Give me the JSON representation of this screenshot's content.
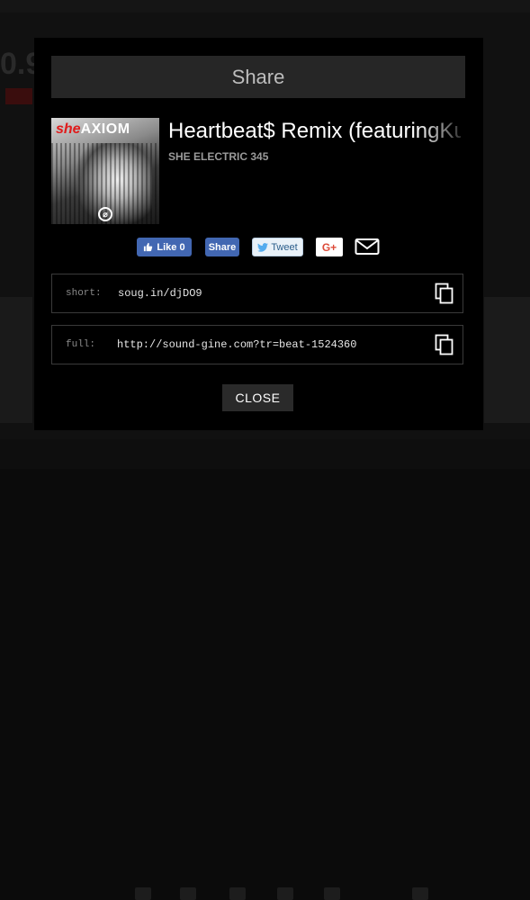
{
  "modal": {
    "title": "Share",
    "track": {
      "title": "Heartbeat$ Remix (featuringKu",
      "artist": "SHE ELECTRIC 345",
      "cover": {
        "brand_red": "she",
        "brand_white": "AXIOM"
      }
    },
    "social": {
      "fb_like": "Like 0",
      "fb_share": "Share",
      "tweet": "Tweet",
      "gplus": "G+"
    },
    "links": {
      "short_label": "short:",
      "short_value": "soug.in/djDO9",
      "full_label": "full:",
      "full_value": "http://sound-gine.com?tr=beat-1524360"
    },
    "close_label": "CLOSE"
  },
  "colors": {
    "modal_bg": "#000000",
    "header_bg": "#262626",
    "facebook": "#4267b2",
    "gplus_red": "#dd4b39"
  },
  "icons": [
    "facebook-icon",
    "twitter-icon",
    "mail-icon",
    "copy-icon",
    "copy-icon"
  ]
}
